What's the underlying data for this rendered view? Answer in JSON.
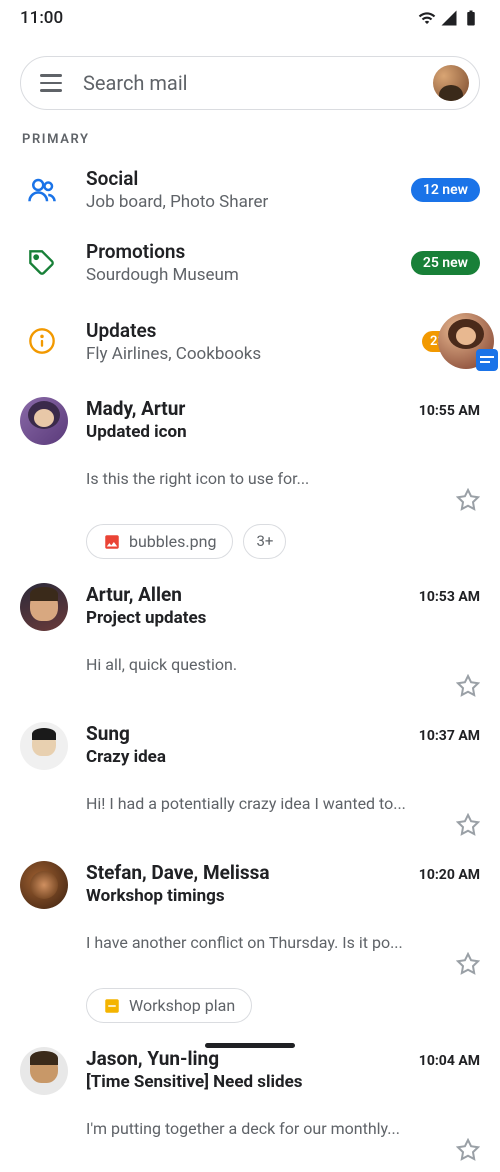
{
  "status": {
    "time": "11:00"
  },
  "search": {
    "placeholder": "Search mail"
  },
  "section_label": "PRIMARY",
  "categories": [
    {
      "title": "Social",
      "subtitle": "Job board, Photo Sharer",
      "badge": "12 new",
      "badge_color": "blue",
      "icon": "people-icon"
    },
    {
      "title": "Promotions",
      "subtitle": "Sourdough Museum",
      "badge": "25 new",
      "badge_color": "green",
      "icon": "tag-icon"
    },
    {
      "title": "Updates",
      "subtitle": "Fly Airlines, Cookbooks",
      "badge": "23",
      "badge_color": "orange",
      "icon": "info-icon"
    }
  ],
  "emails": [
    {
      "sender": "Mady, Artur",
      "time": "10:55 AM",
      "subject": "Updated icon",
      "preview": "Is this the right icon to use for...",
      "attachments": [
        {
          "type": "image",
          "name": "bubbles.png"
        }
      ],
      "more_count": "3+"
    },
    {
      "sender": "Artur, Allen",
      "time": "10:53 AM",
      "subject": "Project updates",
      "preview": "Hi all, quick question."
    },
    {
      "sender": "Sung",
      "time": "10:37 AM",
      "subject": "Crazy idea",
      "preview": "Hi! I had a potentially crazy idea I wanted to..."
    },
    {
      "sender": "Stefan, Dave, Melissa",
      "time": "10:20 AM",
      "subject": "Workshop timings",
      "preview": "I have another conflict on Thursday. Is it po...",
      "attachments": [
        {
          "type": "slides",
          "name": "Workshop plan"
        }
      ]
    },
    {
      "sender": "Jason, Yun-ling",
      "time": "10:04 AM",
      "subject": "[Time Sensitive] Need slides",
      "preview": "I'm putting together a deck for our monthly..."
    }
  ]
}
